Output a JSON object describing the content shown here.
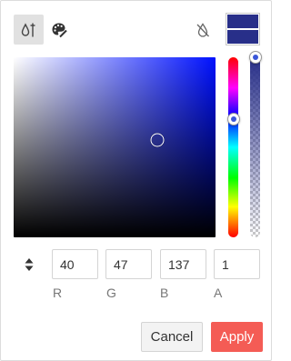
{
  "color": {
    "r": 40,
    "g": 47,
    "b": 137,
    "a": 1,
    "hex": "#282f89",
    "hue_hex": "#0011ff",
    "hue_deg": 236,
    "saturation": 0.71,
    "value": 0.54
  },
  "preview": {
    "current": "#282f89",
    "previous": "#282f89"
  },
  "toolbar": {
    "picker_icon": "eyedropper-icon",
    "palette_icon": "palette-icon",
    "no_color_icon": "no-color-icon"
  },
  "inputs": {
    "r": {
      "value": "40",
      "label": "R"
    },
    "g": {
      "value": "47",
      "label": "G"
    },
    "b": {
      "value": "137",
      "label": "B"
    },
    "a": {
      "value": "1",
      "label": "A"
    }
  },
  "buttons": {
    "cancel_label": "Cancel",
    "apply_label": "Apply"
  },
  "colors": {
    "apply_bg": "#f45c55",
    "border": "#d4d4d4",
    "toolbar_active_bg": "#e1e1e1"
  }
}
